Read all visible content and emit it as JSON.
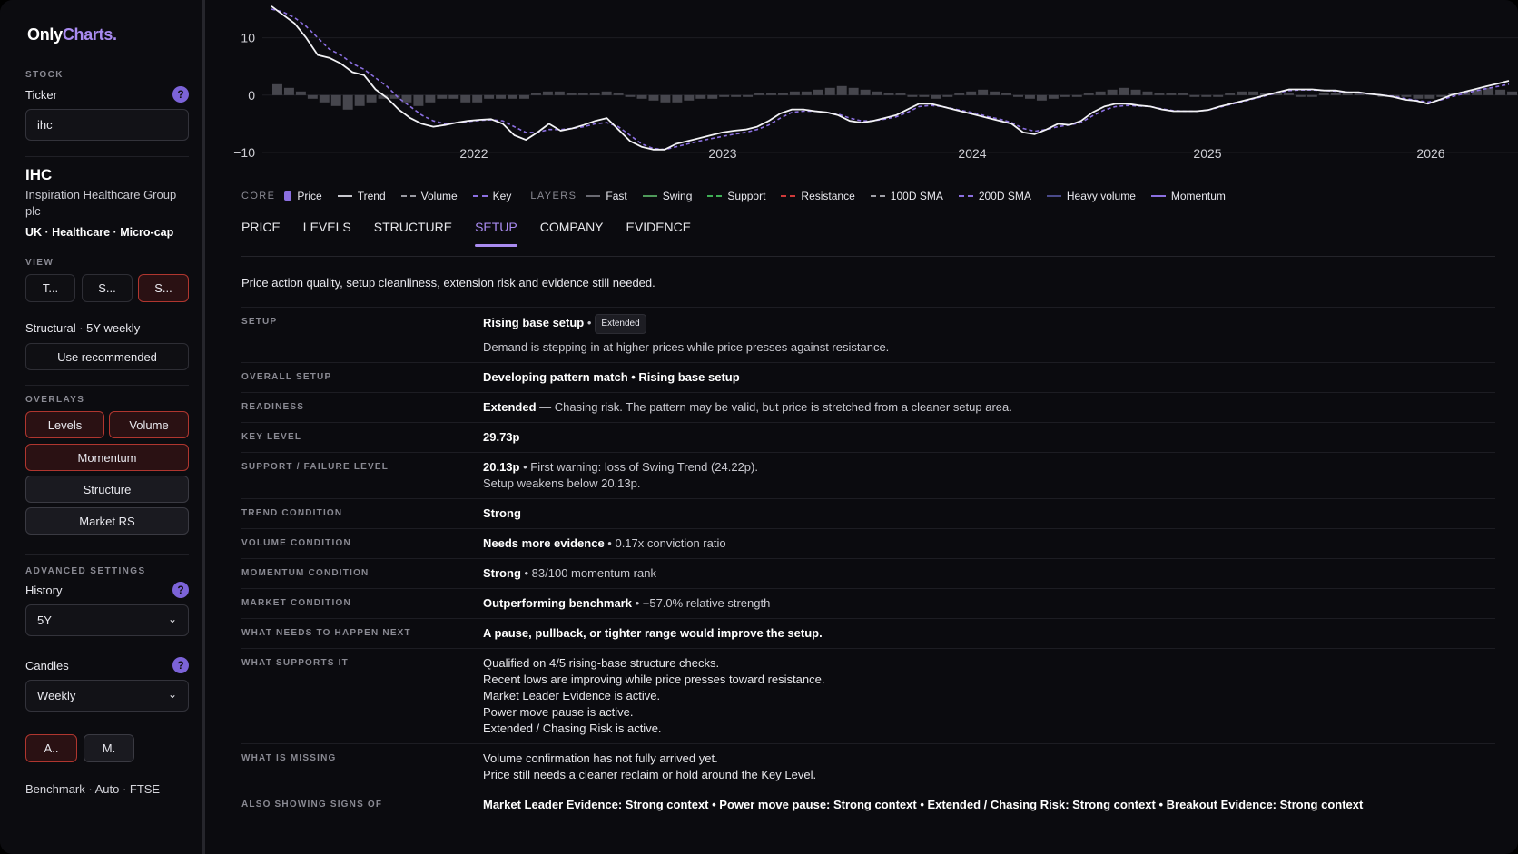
{
  "app": {
    "logo_main": "Only",
    "logo_accent": "Charts."
  },
  "sidebar": {
    "stock_label": "STOCK",
    "ticker_label": "Ticker",
    "ticker_value": "ihc",
    "symbol": "IHC",
    "company_line1": "Inspiration Healthcare Group",
    "company_line2": "plc",
    "meta": "UK · Healthcare · Micro-cap",
    "view_label": "VIEW",
    "view_buttons": [
      "T...",
      "S...",
      "S..."
    ],
    "view_mode": "Structural · 5Y weekly",
    "use_recommended": "Use recommended",
    "overlays_label": "OVERLAYS",
    "overlays": [
      "Levels",
      "Volume",
      "Momentum",
      "Structure",
      "Market RS"
    ],
    "advanced_label": "ADVANCED SETTINGS",
    "history_label": "History",
    "history_value": "5Y",
    "candles_label": "Candles",
    "candles_value": "Weekly",
    "mode_buttons": [
      "A..",
      "M."
    ],
    "benchmark": "Benchmark · Auto · FTSE",
    "help_glyph": "?",
    "chevron": "⌄"
  },
  "chart_data": {
    "type": "line",
    "y_ticks": [
      "10",
      "0",
      "−10"
    ],
    "x_ticks": [
      "2022",
      "2023",
      "2024",
      "2025",
      "2026"
    ],
    "ylim": [
      -10,
      15
    ],
    "grid": true,
    "series": [
      {
        "name": "Price",
        "color": "#f2f2f5",
        "style": "solid",
        "values": [
          15.5,
          14,
          12.5,
          10,
          7,
          6.5,
          5.5,
          4,
          3.5,
          1,
          -0.5,
          -2.5,
          -4,
          -5,
          -5.5,
          -5.2,
          -4.8,
          -4.5,
          -4.3,
          -4.2,
          -5,
          -7,
          -7.8,
          -6.5,
          -5,
          -6.2,
          -5.8,
          -5.2,
          -4.5,
          -4,
          -6,
          -8,
          -9,
          -9.5,
          -9.5,
          -8.5,
          -8,
          -7.5,
          -7,
          -6.5,
          -6.2,
          -6,
          -5.5,
          -4.5,
          -3.2,
          -2.5,
          -2.5,
          -2.8,
          -3,
          -3.5,
          -4.5,
          -4.8,
          -4.5,
          -4,
          -3.5,
          -2.5,
          -1.5,
          -1.5,
          -2,
          -2.5,
          -3,
          -3.5,
          -4,
          -4.5,
          -5,
          -6.5,
          -6.8,
          -6,
          -5,
          -5.2,
          -4.5,
          -3,
          -2,
          -1.5,
          -1.5,
          -1.8,
          -2,
          -2.5,
          -2.8,
          -2.8,
          -2.8,
          -2.6,
          -2,
          -1.5,
          -1,
          -0.5,
          0,
          0.5,
          1,
          1,
          1,
          0.8,
          0.8,
          0.5,
          0.5,
          0.2,
          0,
          -0.3,
          -0.8,
          -1,
          -1.5,
          -0.8,
          0,
          0.5,
          1,
          1.5,
          2,
          2.5
        ]
      },
      {
        "name": "Trend",
        "color": "#8b6fe0",
        "style": "dashed",
        "values": [
          15,
          14.5,
          13.5,
          12,
          10,
          8,
          7,
          5.5,
          4.5,
          3,
          1.5,
          -0.5,
          -2,
          -3.5,
          -4.5,
          -5,
          -4.8,
          -4.6,
          -4.4,
          -4.3,
          -4.5,
          -5.5,
          -6.5,
          -6.5,
          -6,
          -6,
          -5.8,
          -5.5,
          -5,
          -4.8,
          -5.5,
          -7,
          -8.5,
          -9.3,
          -9.5,
          -9,
          -8.5,
          -8,
          -7.6,
          -7.2,
          -6.8,
          -6.5,
          -6,
          -5.2,
          -4,
          -3,
          -2.8,
          -2.8,
          -3,
          -3.3,
          -4,
          -4.5,
          -4.5,
          -4.2,
          -3.8,
          -3,
          -2,
          -1.8,
          -2,
          -2.4,
          -2.8,
          -3.2,
          -3.8,
          -4.2,
          -4.8,
          -5.8,
          -6.3,
          -6,
          -5.5,
          -5.2,
          -4.8,
          -3.6,
          -2.6,
          -2,
          -1.8,
          -1.9,
          -2,
          -2.4,
          -2.7,
          -2.8,
          -2.8,
          -2.6,
          -2.1,
          -1.6,
          -1.1,
          -0.6,
          -0.1,
          0.4,
          0.8,
          0.9,
          0.9,
          0.8,
          0.7,
          0.5,
          0.4,
          0.2,
          0,
          -0.2,
          -0.6,
          -0.9,
          -1.2,
          -0.9,
          -0.3,
          0.2,
          0.7,
          1.1,
          1.5,
          1.9
        ]
      }
    ],
    "volume_bars": [
      3,
      2,
      1,
      -1,
      -2,
      -3,
      -4,
      -3,
      -2,
      -1,
      -1,
      -2,
      -3,
      -2,
      -1,
      -1,
      -2,
      -2,
      -1,
      -1,
      -1,
      -1,
      0.5,
      1,
      1,
      0.5,
      0.5,
      0.5,
      1,
      0.5,
      -0.5,
      -1,
      -1.5,
      -2,
      -2,
      -1.5,
      -1,
      -1,
      -0.5,
      -0.5,
      -0.5,
      0.5,
      0.5,
      0.5,
      1,
      1,
      1.5,
      2,
      2.5,
      2,
      1.5,
      1,
      0.5,
      0.5,
      -0.5,
      -0.5,
      -1,
      -0.5,
      0.5,
      1,
      1.5,
      1,
      0.5,
      -0.5,
      -1,
      -1.5,
      -1,
      -0.5,
      -0.5,
      0.5,
      1,
      1.5,
      2,
      1.5,
      1,
      0.5,
      0.5,
      0.5,
      -0.5,
      -0.5,
      -0.5,
      0.5,
      1,
      1,
      0.5,
      0.5,
      0.5,
      -0.5,
      -0.5,
      0.5,
      0.5,
      0.5,
      0.5,
      0.5,
      -0.5,
      -0.5,
      -0.5,
      -1,
      -1,
      -0.5,
      0.5,
      1,
      1.5,
      2,
      1.5,
      1
    ]
  },
  "legend": {
    "core_label": "CORE",
    "layers_label": "LAYERS",
    "core": [
      {
        "label": "Price",
        "kind": "square",
        "color": "#8b6fe0"
      },
      {
        "label": "Trend",
        "kind": "solid",
        "color": "#c8c8ce"
      },
      {
        "label": "Volume",
        "kind": "dashed",
        "color": "#9a9aa2"
      },
      {
        "label": "Key",
        "kind": "dashed",
        "color": "#8b6fe0"
      }
    ],
    "layers": [
      {
        "label": "Fast",
        "kind": "solid",
        "color": "#6a6a72"
      },
      {
        "label": "Swing",
        "kind": "solid",
        "color": "#4f9a5a"
      },
      {
        "label": "Support",
        "kind": "dashed",
        "color": "#3faf55"
      },
      {
        "label": "Resistance",
        "kind": "dashed",
        "color": "#d03a3a"
      },
      {
        "label": "100D SMA",
        "kind": "dashed",
        "color": "#a0a0a8"
      },
      {
        "label": "200D SMA",
        "kind": "dashed",
        "color": "#8b6fe0"
      },
      {
        "label": "Heavy volume",
        "kind": "solid",
        "color": "#4a4a8a"
      },
      {
        "label": "Momentum",
        "kind": "solid",
        "color": "#8b6fe0"
      }
    ]
  },
  "tabs": [
    "PRICE",
    "LEVELS",
    "STRUCTURE",
    "SETUP",
    "COMPANY",
    "EVIDENCE"
  ],
  "active_tab": "SETUP",
  "setup": {
    "description": "Price action quality, setup cleanliness, extension risk and evidence still needed.",
    "rows": [
      {
        "key": "SETUP",
        "lines": [
          {
            "strong": "Rising base setup",
            "rest": " •",
            "pill": "Extended"
          },
          {
            "strong": "",
            "rest": "Demand is stepping in at higher prices while price presses against resistance."
          }
        ]
      },
      {
        "key": "OVERALL SETUP",
        "lines": [
          {
            "strong": "Developing pattern match • Rising base setup",
            "rest": ""
          }
        ]
      },
      {
        "key": "READINESS",
        "lines": [
          {
            "strong": "Extended",
            "rest": " — Chasing risk. The pattern may be valid, but price is stretched from a cleaner setup area."
          }
        ]
      },
      {
        "key": "KEY LEVEL",
        "lines": [
          {
            "strong": "29.73p",
            "rest": ""
          }
        ]
      },
      {
        "key": "SUPPORT / FAILURE LEVEL",
        "lines": [
          {
            "strong": "20.13p",
            "rest": " • First warning: loss of Swing Trend (24.22p)."
          },
          {
            "strong": "",
            "rest": "Setup weakens below 20.13p."
          }
        ]
      },
      {
        "key": "TREND CONDITION",
        "lines": [
          {
            "strong": "Strong",
            "rest": ""
          }
        ]
      },
      {
        "key": "VOLUME CONDITION",
        "lines": [
          {
            "strong": "Needs more evidence",
            "rest": " • 0.17x conviction ratio"
          }
        ]
      },
      {
        "key": "MOMENTUM CONDITION",
        "lines": [
          {
            "strong": "Strong",
            "rest": " • 83/100 momentum rank"
          }
        ]
      },
      {
        "key": "MARKET CONDITION",
        "lines": [
          {
            "strong": "Outperforming benchmark",
            "rest": " • +57.0% relative strength"
          }
        ]
      },
      {
        "key": "WHAT NEEDS TO HAPPEN NEXT",
        "lines": [
          {
            "strong": "A pause, pullback, or tighter range would improve the setup.",
            "rest": ""
          }
        ]
      },
      {
        "key": "WHAT SUPPORTS IT",
        "lines": [
          {
            "strong": "Qualified on 4/5 rising-base structure checks.",
            "rest": ""
          },
          {
            "strong": "Recent lows are improving while price presses toward resistance.",
            "rest": ""
          },
          {
            "strong": "Market Leader Evidence is active.",
            "rest": ""
          },
          {
            "strong": "Power move pause is active.",
            "rest": ""
          },
          {
            "strong": "Extended / Chasing Risk is active.",
            "rest": ""
          }
        ]
      },
      {
        "key": "WHAT IS MISSING",
        "lines": [
          {
            "strong": "Volume confirmation has not fully arrived yet.",
            "rest": ""
          },
          {
            "strong": "Price still needs a cleaner reclaim or hold around the Key Level.",
            "rest": ""
          }
        ]
      },
      {
        "key": "ALSO SHOWING SIGNS OF",
        "lines": [
          {
            "strong": "Market Leader Evidence: Strong context • Power move pause: Strong context • Extended / Chasing Risk: Strong context • Breakout Evidence: Strong context",
            "rest": ""
          }
        ]
      }
    ]
  }
}
